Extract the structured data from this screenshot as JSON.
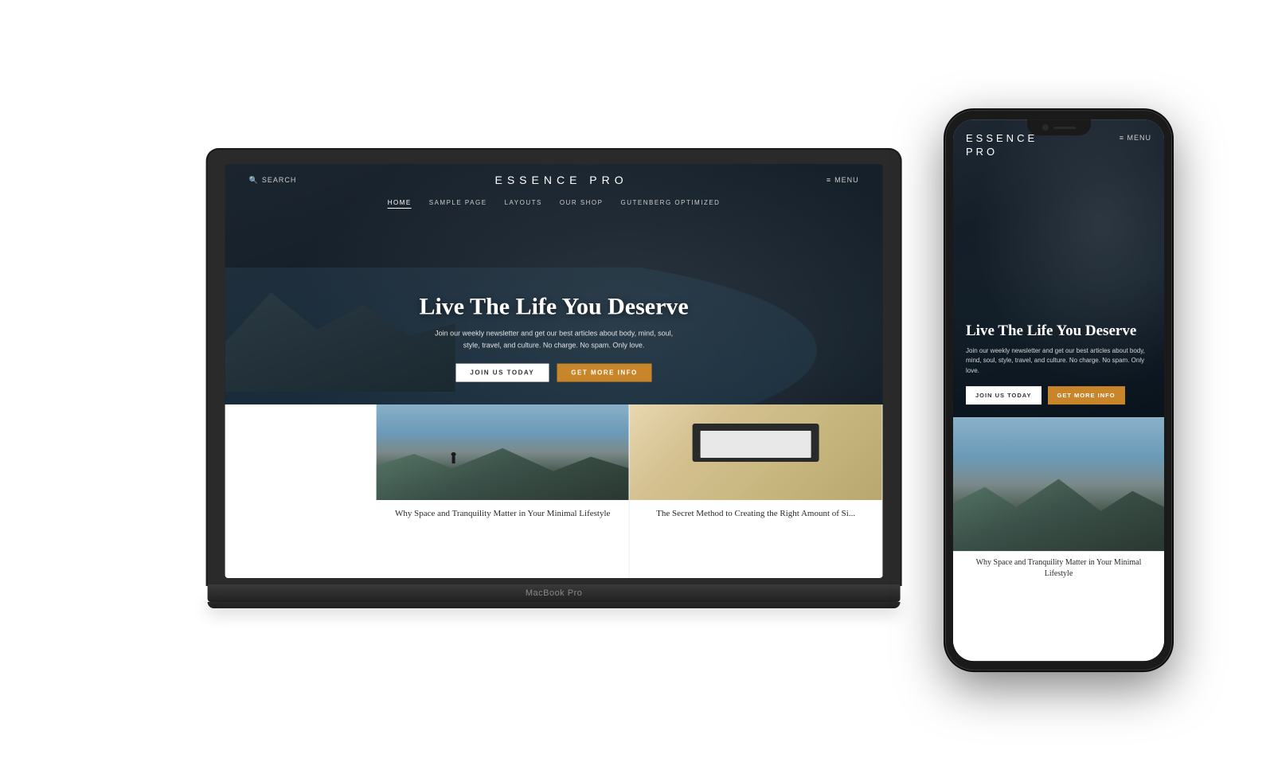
{
  "laptop": {
    "label": "MacBook Pro"
  },
  "website": {
    "header": {
      "search_label": "SEARCH",
      "site_title": "ESSENCE PRO",
      "menu_label": "MENU"
    },
    "nav": {
      "items": [
        {
          "label": "HOME",
          "active": true
        },
        {
          "label": "SAMPLE PAGE",
          "active": false
        },
        {
          "label": "LAYOUTS",
          "active": false
        },
        {
          "label": "OUR SHOP",
          "active": false
        },
        {
          "label": "GUTENBERG OPTIMIZED",
          "active": false
        }
      ]
    },
    "hero": {
      "title": "Live The Life You Deserve",
      "subtitle": "Join our weekly newsletter and get our best articles about body, mind, soul, style, travel, and culture. No charge. No spam. Only love.",
      "btn_primary": "JOIN US TODAY",
      "btn_secondary": "GET MORE INFO"
    },
    "cards": [
      {
        "title": "Why Space and Tranquility Matter in Your Minimal Lifestyle"
      },
      {
        "title": "The Secret Method to Creating the Right Amount of Si..."
      }
    ]
  },
  "phone": {
    "site_title": "ESSENCE\nPRO",
    "menu_label": "≡ MENU",
    "hero": {
      "title": "Live The Life You Deserve",
      "subtitle": "Join our weekly newsletter and get our best articles about body, mind, soul, style, travel, and culture. No charge. No spam. Only love.",
      "btn_primary": "JOIN US TODAY",
      "btn_secondary": "GET MORE INFO"
    },
    "card_title": "Why Space and Tranquility Matter in Your Minimal Lifestyle"
  },
  "colors": {
    "amber": "#c8852a",
    "dark_bg": "#1c2027",
    "white": "#ffffff"
  }
}
